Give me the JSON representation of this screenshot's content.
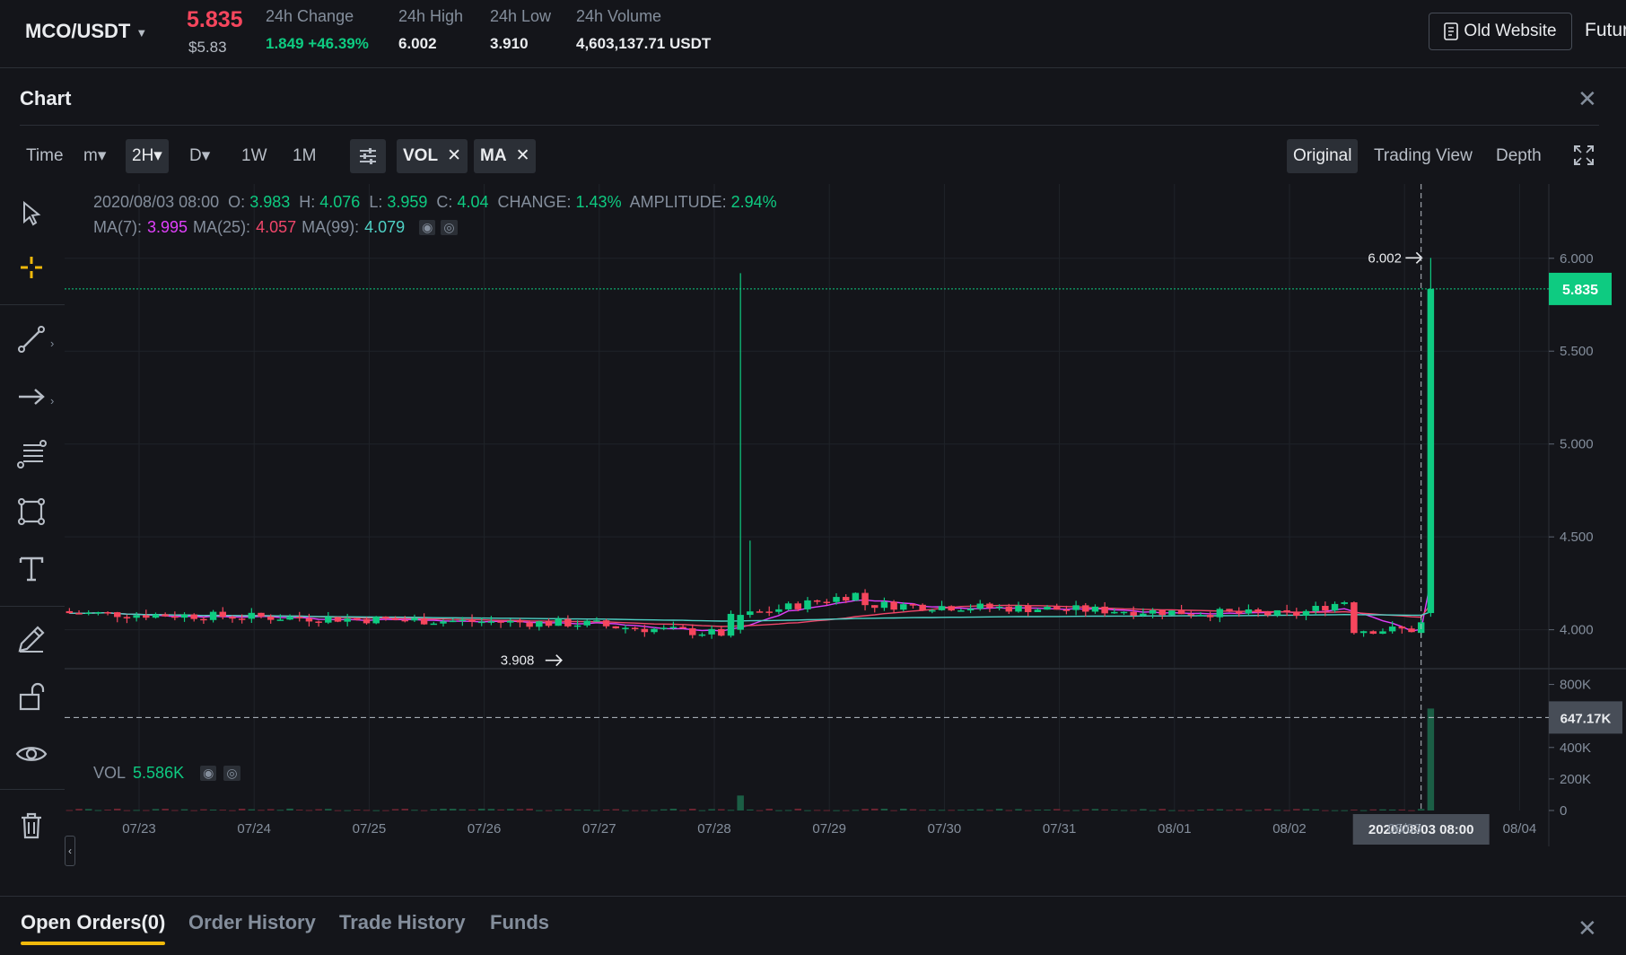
{
  "ticker": {
    "pair": "MCO/USDT",
    "last_price": "5.835",
    "fiat_price": "$5.83",
    "change_label": "24h Change",
    "change_value": "1.849 +46.39%",
    "high_label": "24h High",
    "high_value": "6.002",
    "low_label": "24h Low",
    "low_value": "3.910",
    "volume_label": "24h Volume",
    "volume_value": "4,603,137.71 USDT",
    "old_website": "Old Website",
    "futures": "Futur"
  },
  "chart_panel": {
    "title": "Chart",
    "toolbar": {
      "time": "Time",
      "minutes": "m▾",
      "two_hour": "2H▾",
      "day": "D▾",
      "week": "1W",
      "month": "1M",
      "vol_chip": "VOL",
      "ma_chip": "MA",
      "original": "Original",
      "trading_view": "Trading View",
      "depth": "Depth"
    },
    "info": {
      "date": "2020/08/03 08:00",
      "o_label": "O:",
      "o": "3.983",
      "h_label": "H:",
      "h": "4.076",
      "l_label": "L:",
      "l": "3.959",
      "c_label": "C:",
      "c": "4.04",
      "change_label": "CHANGE:",
      "change": "1.43%",
      "amp_label": "AMPLITUDE:",
      "amp": "2.94%",
      "ma7_label": "MA(7):",
      "ma7": "3.995",
      "ma25_label": "MA(25):",
      "ma25": "4.057",
      "ma99_label": "MA(99):",
      "ma99": "4.079",
      "vol_label": "VOL",
      "vol": "5.586K"
    },
    "annotations": {
      "high_marker": "6.002",
      "low_marker": "3.908",
      "last_price_tag": "5.835",
      "crosshair_vol_tag": "647.17K",
      "crosshair_date": "2020/08/03 08:00"
    },
    "colors": {
      "up": "#0ecb81",
      "down": "#f6465d",
      "ma7": "#e040fb",
      "ma25": "#f0466a",
      "ma99": "#4fd1c5",
      "accent": "#f0b90b"
    }
  },
  "chart_data": {
    "type": "candlestick",
    "price_axis_ticks": [
      "6.000",
      "5.500",
      "5.000",
      "4.500",
      "4.000"
    ],
    "price_ylim": [
      3.8,
      6.4
    ],
    "volume_axis_ticks": [
      "800K",
      "600K",
      "400K",
      "200K",
      "0"
    ],
    "volume_ylim": [
      0,
      900000
    ],
    "x_ticks": [
      "07/23",
      "07/24",
      "07/25",
      "07/26",
      "07/27",
      "07/28",
      "07/29",
      "07/30",
      "07/31",
      "08/01",
      "08/02",
      "08/03",
      "08/04"
    ],
    "key_candles": [
      {
        "time": "07/28 ~00:00",
        "open": 4.0,
        "high": 5.92,
        "low": 3.98,
        "close": 4.08,
        "note": "spike"
      },
      {
        "time": "08/03 08:00",
        "open": 3.983,
        "high": 4.076,
        "low": 3.959,
        "close": 4.04
      },
      {
        "time": "08/03 10:00",
        "open": 4.09,
        "high": 6.002,
        "low": 4.07,
        "close": 5.835
      }
    ],
    "series": [
      {
        "name": "MA(7)",
        "last": 3.995
      },
      {
        "name": "MA(25)",
        "last": 4.057
      },
      {
        "name": "MA(99)",
        "last": 4.079
      }
    ]
  },
  "bottom_tabs": {
    "open_orders": "Open Orders(0)",
    "order_history": "Order History",
    "trade_history": "Trade History",
    "funds": "Funds"
  }
}
